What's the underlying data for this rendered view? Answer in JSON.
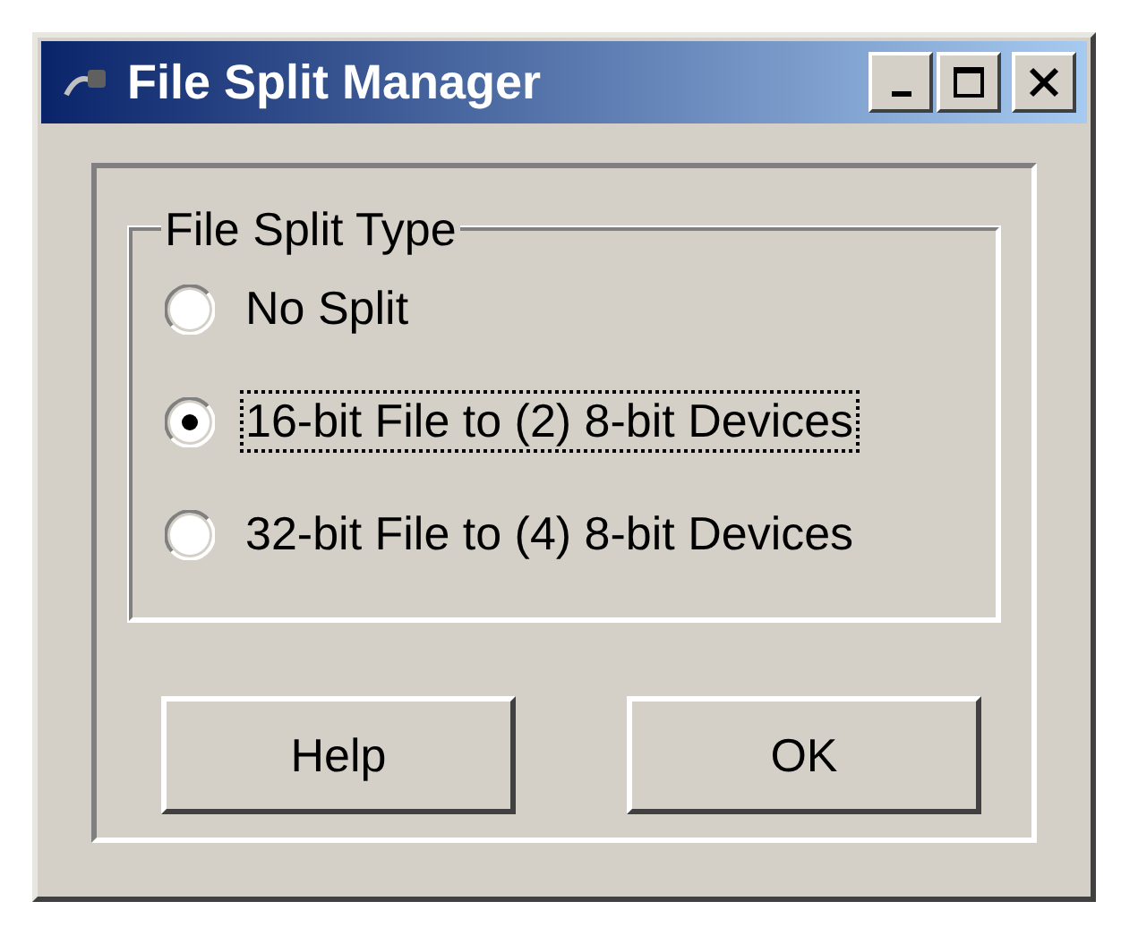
{
  "window": {
    "title": "File Split Manager"
  },
  "group": {
    "title": "File Split Type",
    "options": [
      {
        "label": "No Split",
        "selected": false,
        "focused": false
      },
      {
        "label": "16-bit File to (2) 8-bit Devices",
        "selected": true,
        "focused": true
      },
      {
        "label": "32-bit File to (4) 8-bit Devices",
        "selected": false,
        "focused": false
      }
    ]
  },
  "buttons": [
    "Help",
    "OK"
  ]
}
